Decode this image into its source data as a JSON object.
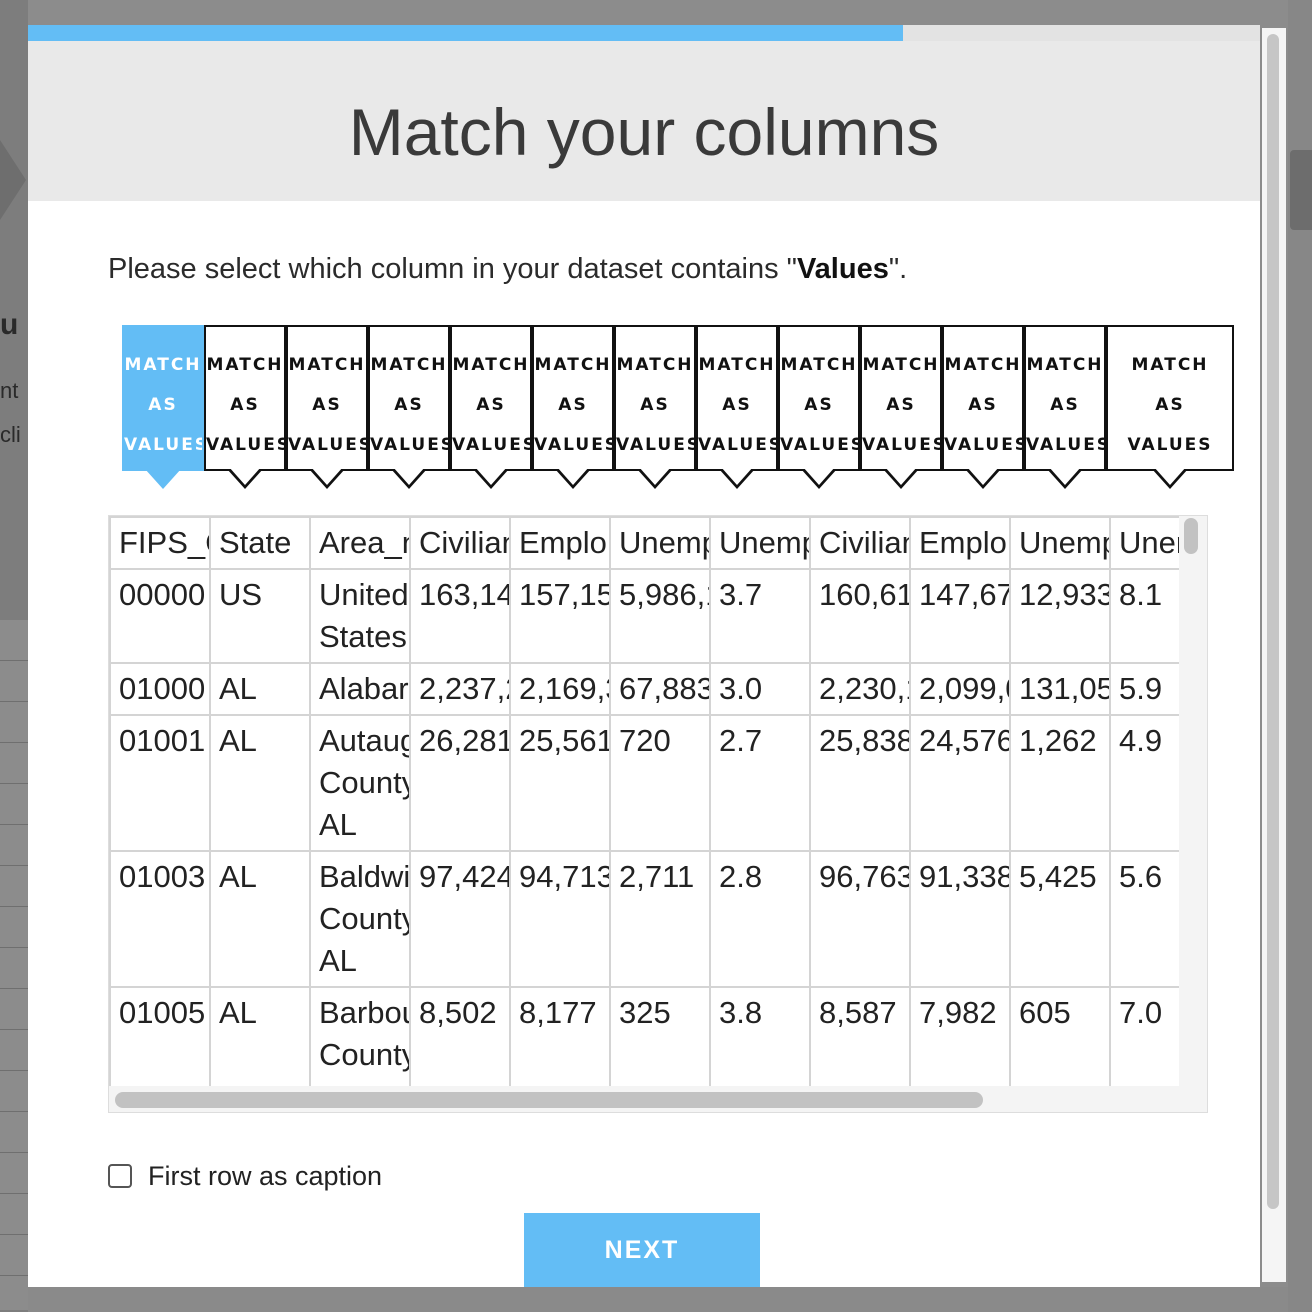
{
  "background": {
    "fragment_lines": [
      "u",
      "nt",
      "cli"
    ]
  },
  "progress": {
    "fraction": 0.71
  },
  "title": "Match your columns",
  "prompt": {
    "prefix": "Please select which column in your dataset contains \"",
    "field": "Values",
    "suffix": "\"."
  },
  "match_buttons": [
    {
      "label": "MATCH AS VALUES",
      "active": true
    },
    {
      "label": "MATCH AS VALUES",
      "active": false
    },
    {
      "label": "MATCH AS VALUES",
      "active": false
    },
    {
      "label": "MATCH AS VALUES",
      "active": false
    },
    {
      "label": "MATCH AS VALUES",
      "active": false
    },
    {
      "label": "MATCH AS VALUES",
      "active": false
    },
    {
      "label": "MATCH AS VALUES",
      "active": false
    },
    {
      "label": "MATCH AS VALUES",
      "active": false
    },
    {
      "label": "MATCH AS VALUES",
      "active": false
    },
    {
      "label": "MATCH AS VALUES",
      "active": false
    },
    {
      "label": "MATCH AS VALUES",
      "active": false
    },
    {
      "label": "MATCH AS VALUES",
      "active": false
    },
    {
      "label": "MATCH AS VALUES",
      "active": false
    }
  ],
  "table": {
    "rows": [
      [
        "FIPS_C",
        "State",
        "Area_n",
        "Civilian",
        "Emplo",
        "Unemp",
        "Unemp",
        "Civilian",
        "Emplo",
        "Unemp",
        "Uner"
      ],
      [
        "00000",
        "US",
        "United States",
        "163,14",
        "157,15",
        "5,986,1",
        "3.7",
        "160,61",
        "147,67",
        "12,933",
        "8.1"
      ],
      [
        "01000",
        "AL",
        "Alabar",
        "2,237,2",
        "2,169,3",
        "67,883",
        "3.0",
        "2,230,1",
        "2,099,0",
        "131,05",
        "5.9"
      ],
      [
        "01001",
        "AL",
        "Autaug County AL",
        "26,281",
        "25,561",
        "720",
        "2.7",
        "25,838",
        "24,576",
        "1,262",
        "4.9"
      ],
      [
        "01003",
        "AL",
        "Baldwi County AL",
        "97,424",
        "94,713",
        "2,711",
        "2.8",
        "96,763",
        "91,338",
        "5,425",
        "5.6"
      ],
      [
        "01005",
        "AL",
        "Barbou County AL",
        "8,502",
        "8,177",
        "325",
        "3.8",
        "8,587",
        "7,982",
        "605",
        "7.0"
      ]
    ]
  },
  "checkbox": {
    "label": "First row as caption",
    "checked": false
  },
  "next_button": {
    "label": "NEXT"
  }
}
